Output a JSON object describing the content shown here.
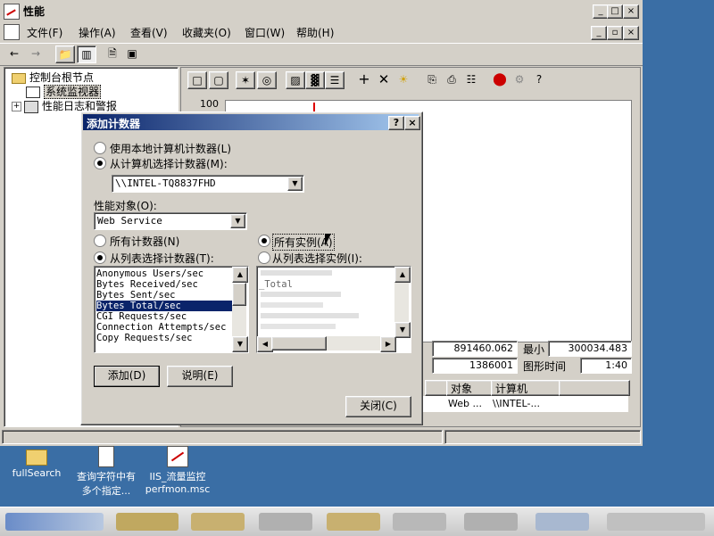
{
  "window": {
    "title": "性能",
    "menus": [
      "文件(F)",
      "操作(A)",
      "查看(V)",
      "收藏夹(O)",
      "窗口(W)",
      "帮助(H)"
    ],
    "caption_buttons": [
      "_",
      "□",
      "×"
    ],
    "mdi_buttons": [
      "_",
      "▫",
      "×"
    ]
  },
  "tree": {
    "root": "控制台根节点",
    "items": [
      "系统监视器",
      "性能日志和警报"
    ],
    "expand_symbol": "+"
  },
  "graph": {
    "y_top": "100"
  },
  "info": {
    "avg_value": "891460.062",
    "min_label": "最小",
    "min_value": "300034.483",
    "max_value": "1386001",
    "time_label": "图形时间",
    "time_value": "1:40",
    "col_object": "对象",
    "col_computer": "计算机",
    "row_object": "Web ...",
    "row_computer": "\\\\INTEL-..."
  },
  "dialog": {
    "title": "添加计数器",
    "help_btn": "?",
    "close_x": "×",
    "radio_local": "使用本地计算机计数器(L)",
    "radio_select": "从计算机选择计数器(M):",
    "computer": "\\\\INTEL-TQ8837FHD",
    "perf_object_label": "性能对象(O):",
    "perf_object": "Web Service",
    "all_counters": "所有计数器(N)",
    "select_counters": "从列表选择计数器(T):",
    "all_instances": "所有实例(A)",
    "select_instances": "从列表选择实例(I):",
    "counters": [
      "Anonymous Users/sec",
      "Bytes Received/sec",
      "Bytes Sent/sec",
      "Bytes Total/sec",
      "CGI Requests/sec",
      "Connection Attempts/sec",
      "Copy Requests/sec"
    ],
    "selected_counter": "Bytes Total/sec",
    "instances": [
      "_Total"
    ],
    "add_btn": "添加(D)",
    "explain_btn": "说明(E)",
    "close_btn": "关闭(C)"
  },
  "desktop": {
    "icons": [
      {
        "label1": "fullSearch",
        "label2": ""
      },
      {
        "label1": "查询字符中有",
        "label2": "多个指定..."
      },
      {
        "label1": "IIS_流量监控",
        "label2": "perfmon.msc"
      }
    ]
  }
}
